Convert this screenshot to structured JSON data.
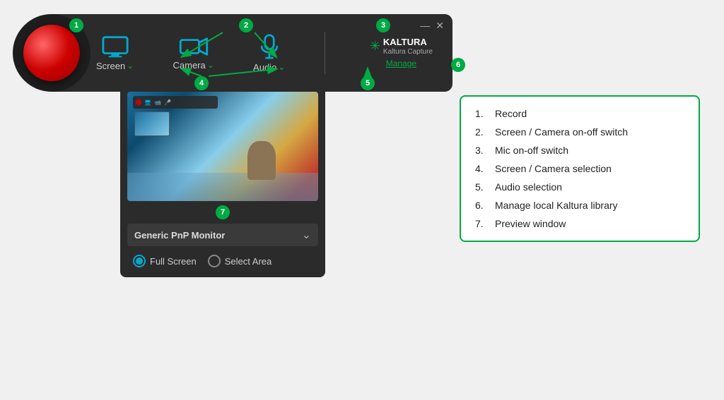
{
  "app": {
    "title": "Kaltura Capture"
  },
  "recorder": {
    "record_label": "Record",
    "screen_label": "Screen",
    "camera_label": "Camera",
    "audio_label": "Audio",
    "manage_label": "Manage",
    "monitor_label": "Generic PnP Monitor",
    "full_screen_label": "Full Screen",
    "select_area_label": "Select Area"
  },
  "annotations": {
    "badge_1": "1",
    "badge_2": "2",
    "badge_3": "3",
    "badge_4": "4",
    "badge_5": "5",
    "badge_6": "6",
    "badge_7": "7"
  },
  "info_list": [
    {
      "num": "1.",
      "text": "Record"
    },
    {
      "num": "2.",
      "text": "Screen / Camera on-off switch"
    },
    {
      "num": "3.",
      "text": "Mic on-off switch"
    },
    {
      "num": "4.",
      "text": "Screen / Camera selection"
    },
    {
      "num": "5.",
      "text": "Audio selection"
    },
    {
      "num": "6.",
      "text": "Manage local Kaltura library"
    },
    {
      "num": "7.",
      "text": "Preview window"
    }
  ],
  "window_controls": {
    "minimize": "—",
    "close": "✕"
  }
}
